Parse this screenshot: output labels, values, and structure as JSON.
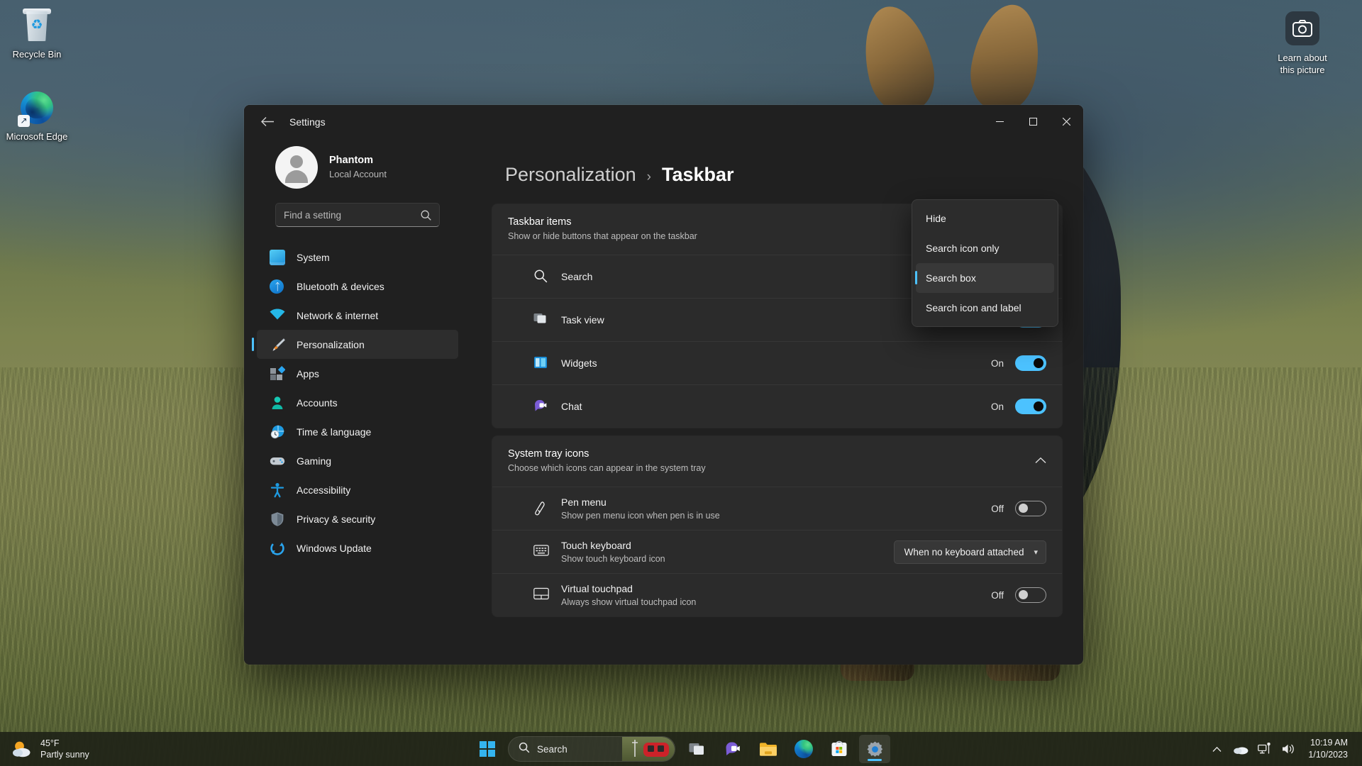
{
  "desktop": {
    "icons": [
      {
        "name": "Recycle Bin",
        "icon": "recycle-bin-icon"
      },
      {
        "name": "Microsoft Edge",
        "icon": "edge-icon"
      }
    ],
    "learn_widget": {
      "line1": "Learn about",
      "line2": "this picture",
      "icon": "camera-icon"
    }
  },
  "window": {
    "app_title": "Settings",
    "back_icon": "back-arrow-icon",
    "controls": {
      "minimize": "minimize-icon",
      "maximize": "maximize-icon",
      "close": "close-icon"
    }
  },
  "sidebar": {
    "account": {
      "name": "Phantom",
      "type": "Local Account"
    },
    "search": {
      "placeholder": "Find a setting",
      "icon": "search-icon"
    },
    "items": [
      {
        "label": "System",
        "icon": "system-icon",
        "active": false
      },
      {
        "label": "Bluetooth & devices",
        "icon": "bluetooth-icon",
        "active": false
      },
      {
        "label": "Network & internet",
        "icon": "wifi-icon",
        "active": false
      },
      {
        "label": "Personalization",
        "icon": "paintbrush-icon",
        "active": true
      },
      {
        "label": "Apps",
        "icon": "apps-icon",
        "active": false
      },
      {
        "label": "Accounts",
        "icon": "accounts-icon",
        "active": false
      },
      {
        "label": "Time & language",
        "icon": "clock-globe-icon",
        "active": false
      },
      {
        "label": "Gaming",
        "icon": "gamepad-icon",
        "active": false
      },
      {
        "label": "Accessibility",
        "icon": "accessibility-icon",
        "active": false
      },
      {
        "label": "Privacy & security",
        "icon": "shield-icon",
        "active": false
      },
      {
        "label": "Windows Update",
        "icon": "update-icon",
        "active": false
      }
    ]
  },
  "breadcrumb": {
    "parent": "Personalization",
    "separator": "›",
    "current": "Taskbar"
  },
  "taskbar_items_card": {
    "title": "Taskbar items",
    "subtitle": "Show or hide buttons that appear on the taskbar",
    "rows": [
      {
        "label": "Search",
        "icon": "search-icon",
        "control": "dropdown",
        "value": ""
      },
      {
        "label": "Task view",
        "icon": "task-view-icon",
        "control": "toggle",
        "state": "On"
      },
      {
        "label": "Widgets",
        "icon": "widgets-icon",
        "control": "toggle",
        "state": "On"
      },
      {
        "label": "Chat",
        "icon": "chat-icon",
        "control": "toggle",
        "state": "On"
      }
    ]
  },
  "search_dropdown": {
    "expanded": true,
    "options": [
      "Hide",
      "Search icon only",
      "Search box",
      "Search icon and label"
    ],
    "selected": "Search box",
    "accent": "#4cc2ff"
  },
  "system_tray_card": {
    "title": "System tray icons",
    "subtitle": "Choose which icons can appear in the system tray",
    "collapse_icon": "chevron-up-icon",
    "rows": [
      {
        "label": "Pen menu",
        "sublabel": "Show pen menu icon when pen is in use",
        "icon": "pen-icon",
        "control": "toggle",
        "state": "Off"
      },
      {
        "label": "Touch keyboard",
        "sublabel": "Show touch keyboard icon",
        "icon": "keyboard-icon",
        "control": "dropdown",
        "value": "When no keyboard attached"
      },
      {
        "label": "Virtual touchpad",
        "sublabel": "Always show virtual touchpad icon",
        "icon": "touchpad-icon",
        "control": "toggle",
        "state": "Off"
      }
    ]
  },
  "system_taskbar": {
    "weather": {
      "temperature": "45°F",
      "condition": "Partly sunny",
      "icon": "partly-sunny-icon"
    },
    "search": {
      "placeholder": "Search",
      "icon": "search-icon"
    },
    "buttons": [
      {
        "name": "start-button",
        "icon": "windows-logo-icon"
      },
      {
        "name": "task-view-button",
        "icon": "task-view-icon"
      },
      {
        "name": "chat-button",
        "icon": "chat-icon"
      },
      {
        "name": "file-explorer-button",
        "icon": "folder-icon"
      },
      {
        "name": "edge-button",
        "icon": "edge-icon"
      },
      {
        "name": "store-button",
        "icon": "microsoft-store-icon"
      },
      {
        "name": "settings-button",
        "icon": "gear-icon"
      }
    ],
    "tray": [
      {
        "name": "show-hidden-icons",
        "icon": "chevron-up-icon"
      },
      {
        "name": "onedrive-icon",
        "icon": "cloud-icon"
      },
      {
        "name": "network-icon",
        "icon": "network-icon"
      },
      {
        "name": "volume-icon",
        "icon": "speaker-icon"
      }
    ],
    "clock": {
      "time": "10:19 AM",
      "date": "1/10/2023"
    }
  }
}
